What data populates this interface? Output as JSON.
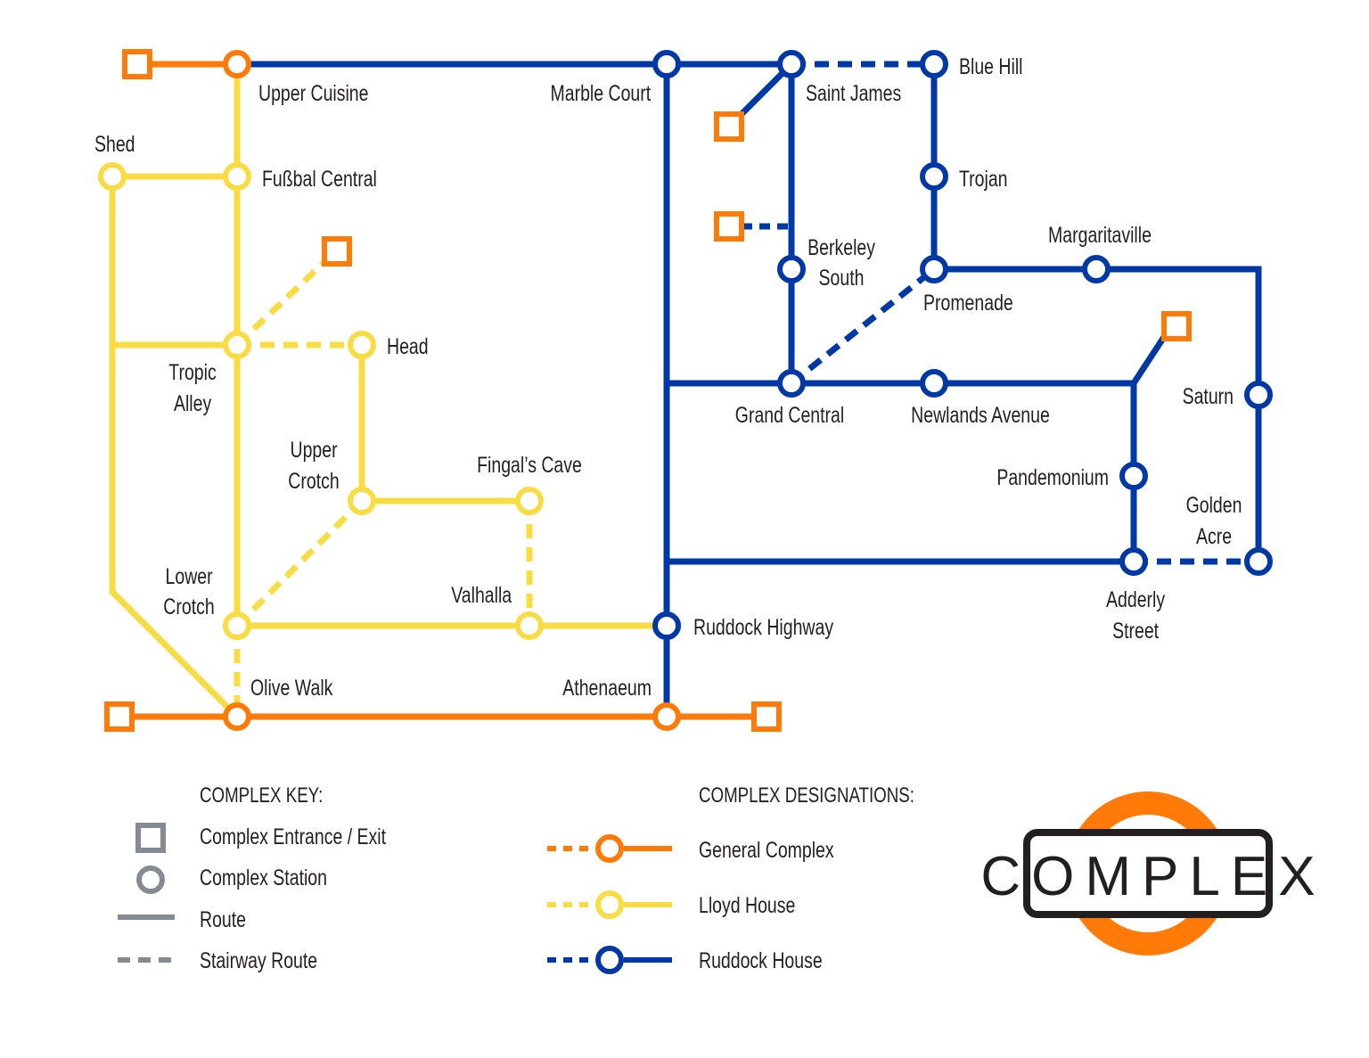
{
  "colors": {
    "general": "#ff7a06",
    "lloyd": "#f9dc43",
    "ruddock": "#0039a6",
    "key_gray": "#858b92",
    "text": "#231f20"
  },
  "stations": {
    "upper_cuisine": "Upper Cuisine",
    "marble_court": "Marble Court",
    "saint_james": "Saint James",
    "blue_hill": "Blue Hill",
    "shed": "Shed",
    "fussbal_central": "Fußbal Central",
    "trojan": "Trojan",
    "berkeley_south_1": "Berkeley",
    "berkeley_south_2": "South",
    "margaritaville": "Margaritaville",
    "promenade": "Promenade",
    "head": "Head",
    "tropic_alley_1": "Tropic",
    "tropic_alley_2": "Alley",
    "grand_central": "Grand Central",
    "newlands_avenue": "Newlands Avenue",
    "saturn": "Saturn",
    "upper_crotch_1": "Upper",
    "upper_crotch_2": "Crotch",
    "fingals_cave": "Fingal’s Cave",
    "pandemonium": "Pandemonium",
    "golden_acre_1": "Golden",
    "golden_acre_2": "Acre",
    "lower_crotch_1": "Lower",
    "lower_crotch_2": "Crotch",
    "valhalla": "Valhalla",
    "ruddock_highway": "Ruddock Highway",
    "adderly_street_1": "Adderly",
    "adderly_street_2": "Street",
    "olive_walk": "Olive Walk",
    "athenaeum": "Athenaeum"
  },
  "legend": {
    "key_title": "COMPLEX KEY:",
    "key_items": [
      {
        "icon": "square-icon",
        "label": "Complex Entrance / Exit"
      },
      {
        "icon": "circle-icon",
        "label": "Complex Station"
      },
      {
        "icon": "solid-line-icon",
        "label": "Route"
      },
      {
        "icon": "dashed-line-icon",
        "label": "Stairway Route"
      }
    ],
    "designations_title": "COMPLEX DESIGNATIONS:",
    "designations": [
      {
        "label": "General Complex",
        "color": "#ff7a06"
      },
      {
        "label": "Lloyd House",
        "color": "#f9dc43"
      },
      {
        "label": "Ruddock House",
        "color": "#0039a6"
      }
    ]
  },
  "logo": {
    "text": "COMPLEX"
  }
}
